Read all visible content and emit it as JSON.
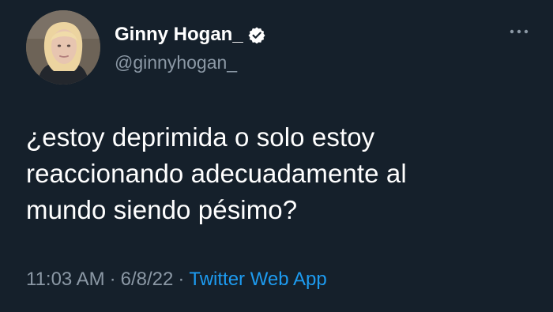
{
  "tweet": {
    "author": {
      "display_name": "Ginny Hogan_",
      "handle": "@ginnyhogan_",
      "verified": true
    },
    "text": "¿estoy deprimida o solo estoy\nreaccionando adecuadamente al\nmundo siendo pésimo?",
    "meta": {
      "time": "11:03 AM",
      "separator": "·",
      "date": "6/8/22",
      "source": "Twitter Web App"
    }
  },
  "theme": {
    "background": "#15202b",
    "primary_text": "#ffffff",
    "secondary_text": "#8b98a5",
    "accent": "#1d9bf0"
  },
  "icons": {
    "verified": "verified-badge-icon",
    "more": "more-options-icon"
  }
}
